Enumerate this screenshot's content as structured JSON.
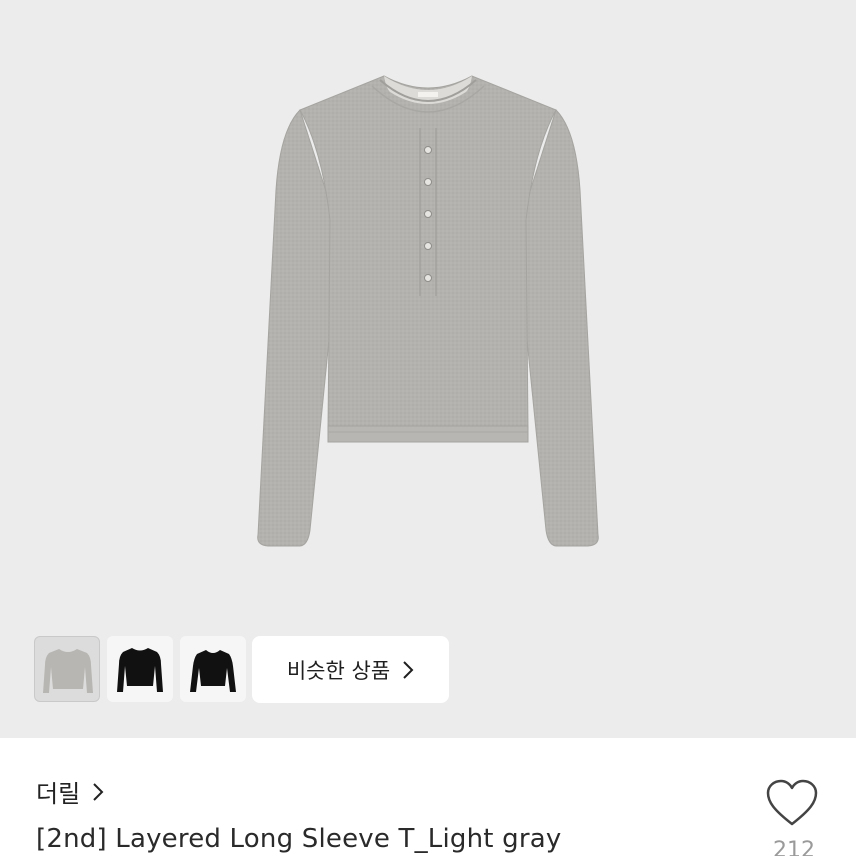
{
  "product": {
    "brand": "더릴",
    "title": "[2nd] Layered Long Sleeve T_Light gray",
    "like_count": "212"
  },
  "gallery": {
    "thumbnails": [
      {
        "name": "light-gray",
        "color": "#b8b6b2",
        "selected": true
      },
      {
        "name": "black-1",
        "color": "#111111",
        "selected": false
      },
      {
        "name": "black-2",
        "color": "#111111",
        "selected": false
      }
    ],
    "similar_button_label": "비슷한 상품"
  },
  "colors": {
    "hero_bg": "#ececec",
    "garment": "#b3b2ae",
    "text_primary": "#222222",
    "text_secondary": "#9a9a9a"
  },
  "icons": [
    "chevron-right-icon",
    "heart-outline-icon"
  ]
}
